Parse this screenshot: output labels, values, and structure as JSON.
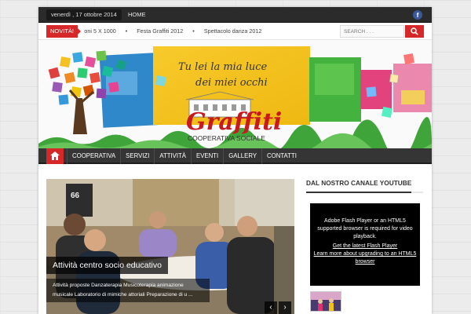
{
  "topbar": {
    "date": "venerdì , 17 ottobre 2014",
    "home_label": "HOME",
    "facebook_glyph": "f"
  },
  "news": {
    "badge": "NOVITÀ!",
    "items": [
      "Donazioni 5 X 1000",
      "Festa Graffiti 2012",
      "Spettacolo danza 2012"
    ],
    "search_placeholder": "SEARCH . . ."
  },
  "banner": {
    "message_line1": "Tu lei la mia luce",
    "message_line2": "dei miei occhi",
    "brand": "Graffiti",
    "subtitle": "COOPERATIVA SOCIALE"
  },
  "nav": {
    "items": [
      "COOPERATIVA",
      "SERVIZI",
      "ATTIVITÀ",
      "EVENTI",
      "GALLERY",
      "CONTATTI"
    ]
  },
  "slider": {
    "title": "Attività centro socio educativo",
    "desc_line1": "Attività proposte Danzaterapia Musicoterapia animazione",
    "desc_line2": "musicale Laboratorio di mimiche attoriali Preparazione di u ...",
    "prev": "‹",
    "next": "›"
  },
  "sidebar": {
    "title": "DAL NOSTRO CANALE YOUTUBE",
    "video_text": "Adobe Flash Player or an HTML5 supported browser is required for video playback.",
    "link1": "Get the latest Flash Player",
    "link2": "Learn more about upgrading to an HTML5 browser"
  },
  "colors": {
    "accent": "#d62828",
    "nav_bg": "#353535",
    "topbar_bg": "#2b2b2b",
    "facebook": "#3b5998"
  }
}
